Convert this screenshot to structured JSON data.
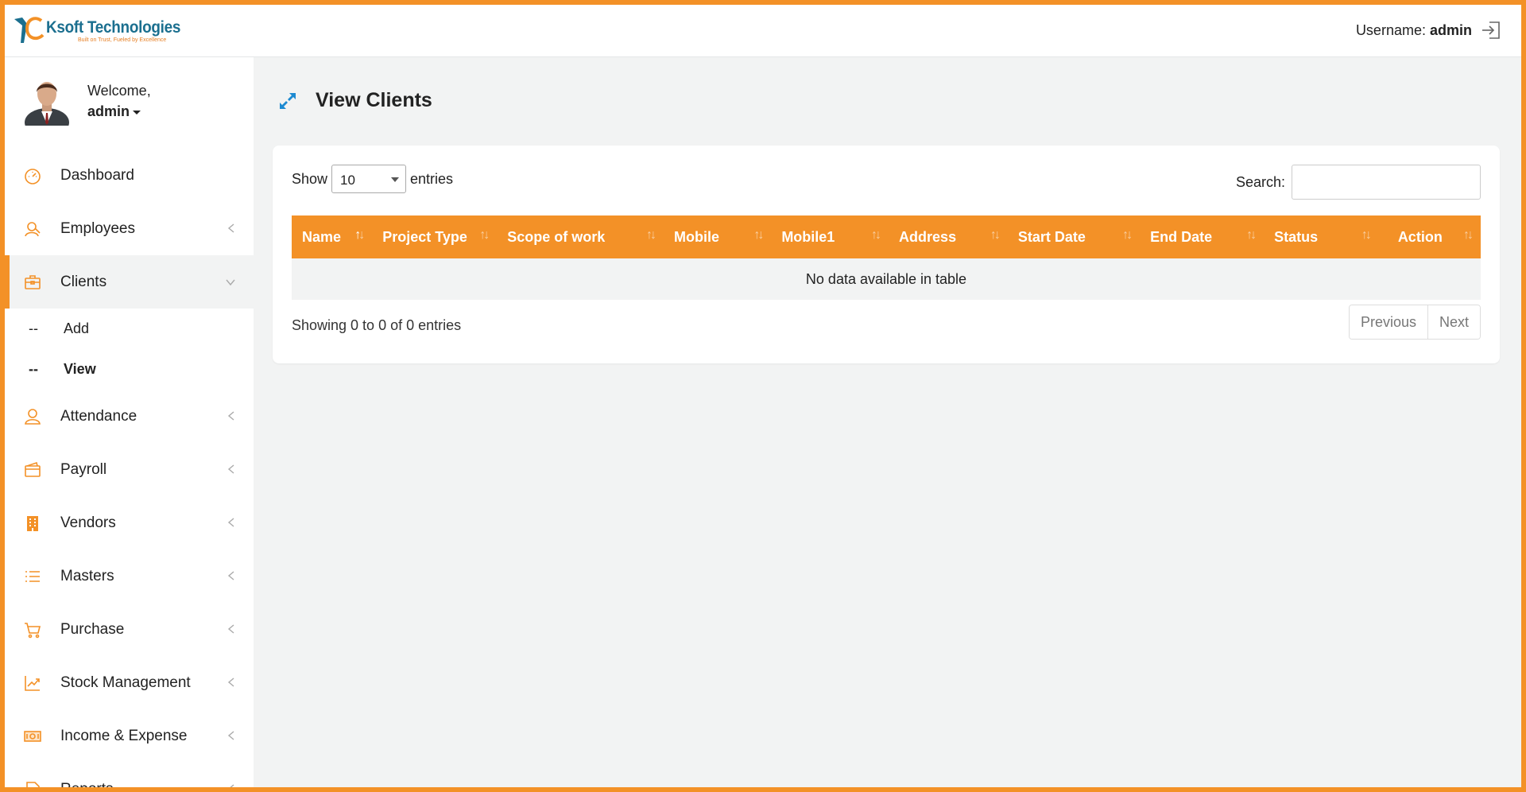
{
  "brand": {
    "title": "Ksoft Technologies",
    "tagline": "Built on Trust, Fueled by Excellence",
    "accent": "#f39127",
    "primary": "#1b6f8f"
  },
  "header": {
    "username_label": "Username:",
    "username_value": "admin",
    "logout_icon": "logout-icon"
  },
  "sidebar": {
    "welcome_label": "Welcome,",
    "user": "admin",
    "items": [
      {
        "label": "Dashboard",
        "icon": "dashboard-icon"
      },
      {
        "label": "Employees",
        "icon": "employees-icon"
      },
      {
        "label": "Clients",
        "icon": "briefcase-icon"
      },
      {
        "label": "Attendance",
        "icon": "user-icon"
      },
      {
        "label": "Payroll",
        "icon": "wallet-icon"
      },
      {
        "label": "Vendors",
        "icon": "building-icon"
      },
      {
        "label": "Masters",
        "icon": "list-icon"
      },
      {
        "label": "Purchase",
        "icon": "cart-icon"
      },
      {
        "label": "Stock Management",
        "icon": "chart-icon"
      },
      {
        "label": "Income & Expense",
        "icon": "money-icon"
      },
      {
        "label": "Reports",
        "icon": "report-icon"
      }
    ],
    "clients_sub": [
      {
        "dash": "--",
        "label": "Add"
      },
      {
        "dash": "--",
        "label": "View"
      }
    ]
  },
  "main": {
    "title": "View Clients",
    "show_label": "Show",
    "entries_value": "10",
    "entries_label": "entries",
    "search_label": "Search:",
    "search_value": "",
    "columns": [
      "Name",
      "Project Type",
      "Scope of work",
      "Mobile",
      "Mobile1",
      "Address",
      "Start Date",
      "End Date",
      "Status",
      "Action"
    ],
    "empty_message": "No data available in table",
    "info": "Showing 0 to 0 of 0 entries",
    "prev_label": "Previous",
    "next_label": "Next"
  }
}
